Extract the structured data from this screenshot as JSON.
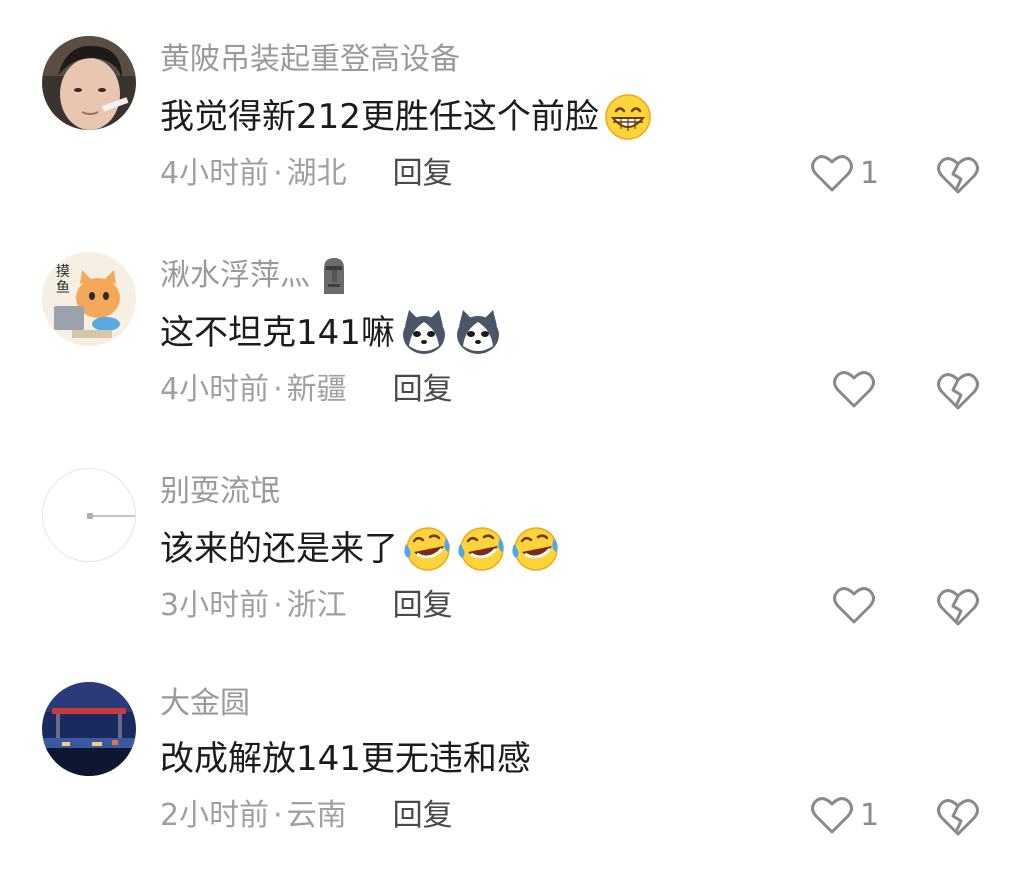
{
  "comments": [
    {
      "username": "黄陂吊装起重登高设备",
      "text": "我觉得新212更胜任这个前脸",
      "emojis": [
        "grinning-face-emoji"
      ],
      "time": "4小时前",
      "location": "湖北",
      "reply_label": "回复",
      "like_count": "1"
    },
    {
      "username": "湫水浮萍灬",
      "text": "这不坦克141嘛",
      "emojis": [
        "husky-dog-emoji",
        "husky-dog-emoji"
      ],
      "time": "4小时前",
      "location": "新疆",
      "reply_label": "回复",
      "like_count": ""
    },
    {
      "username": "别耍流氓",
      "text": "该来的还是来了",
      "emojis": [
        "tears-of-joy-emoji",
        "tears-of-joy-emoji",
        "tears-of-joy-emoji"
      ],
      "time": "3小时前",
      "location": "浙江",
      "reply_label": "回复",
      "like_count": ""
    },
    {
      "username": "大金圆",
      "text": "改成解放141更无违和感",
      "emojis": [],
      "time": "2小时前",
      "location": "云南",
      "reply_label": "回复",
      "like_count": "1"
    }
  ],
  "meta_separator": "·",
  "colors": {
    "username": "#9a9a9a",
    "content": "#1c1c1c",
    "meta": "#a0a0a0",
    "reply": "#4a4a4a",
    "icon_stroke": "#8a8a8a"
  }
}
